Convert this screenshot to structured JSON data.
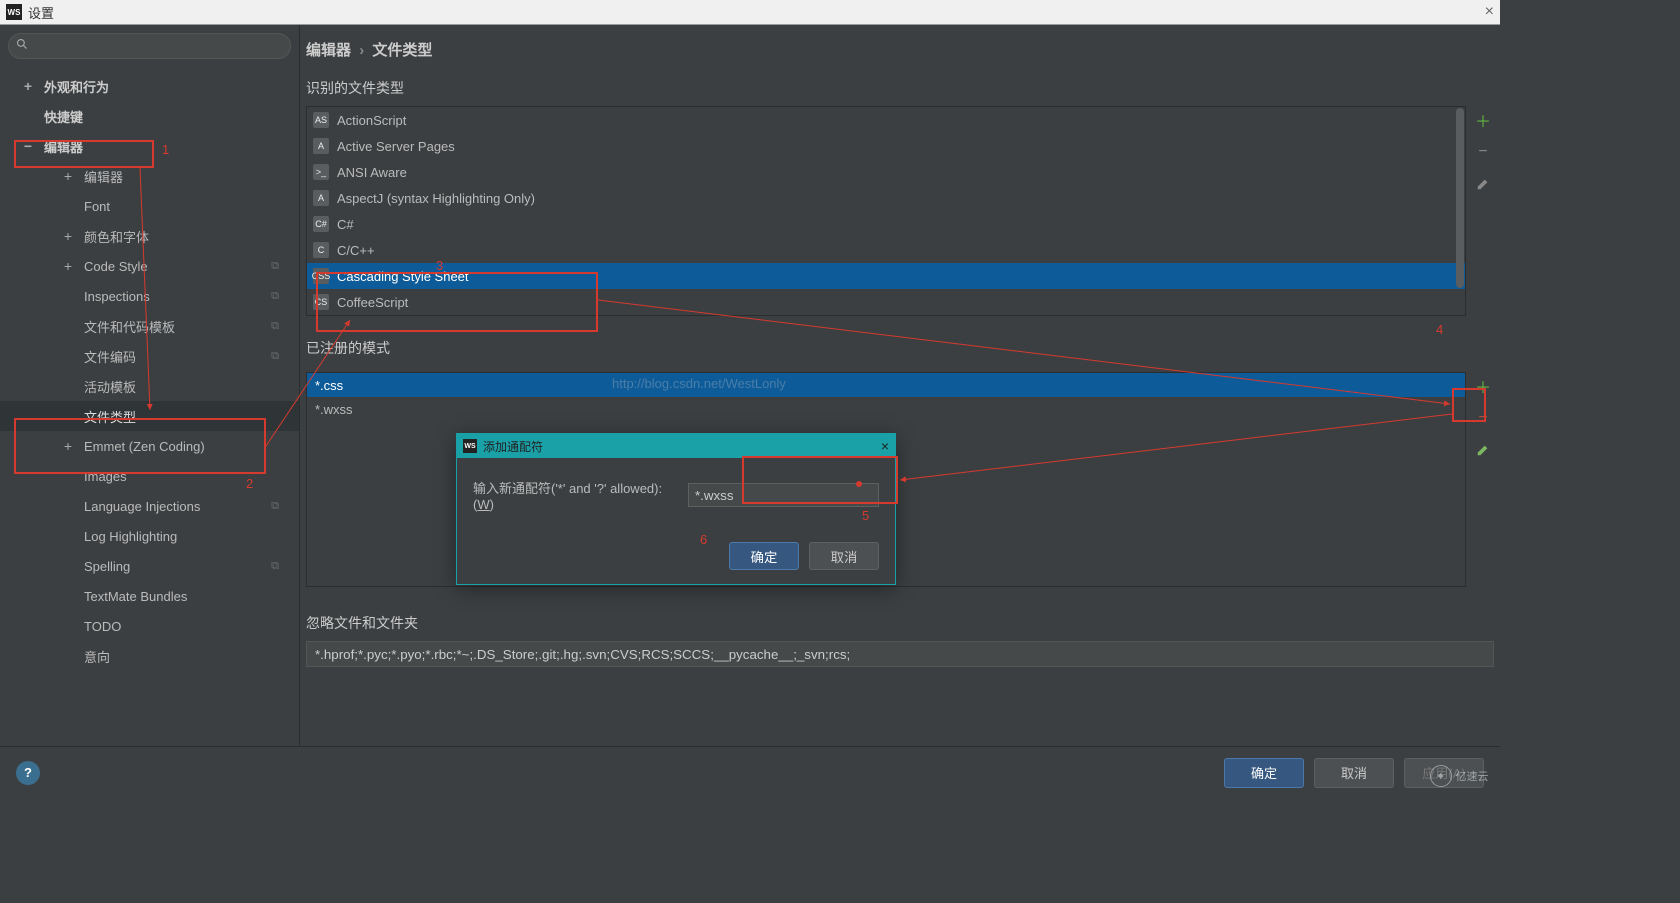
{
  "titlebar": {
    "icon": "WS",
    "title": "设置"
  },
  "search": {
    "placeholder": ""
  },
  "breadcrumb": {
    "part1": "编辑器",
    "sep": "›",
    "part2": "文件类型"
  },
  "sidebar": {
    "items": [
      {
        "exp": "+",
        "label": "外观和行为",
        "bold": true
      },
      {
        "exp": "",
        "label": "快捷键",
        "bold": true
      },
      {
        "exp": "−",
        "label": "编辑器",
        "bold": true
      },
      {
        "exp": "+",
        "label": "编辑器",
        "l2": true
      },
      {
        "exp": "",
        "label": "Font",
        "l2": true
      },
      {
        "exp": "+",
        "label": "颜色和字体",
        "l2": true
      },
      {
        "exp": "+",
        "label": "Code Style",
        "l2": true,
        "copy": true
      },
      {
        "exp": "",
        "label": "Inspections",
        "l2": true,
        "copy": true
      },
      {
        "exp": "",
        "label": "文件和代码模板",
        "l2": true,
        "copy": true
      },
      {
        "exp": "",
        "label": "文件编码",
        "l2": true,
        "copy": true
      },
      {
        "exp": "",
        "label": "活动模板",
        "l2": true
      },
      {
        "exp": "",
        "label": "文件类型",
        "l2": true,
        "selected": true
      },
      {
        "exp": "+",
        "label": "Emmet (Zen Coding)",
        "l2": true
      },
      {
        "exp": "",
        "label": "Images",
        "l2": true
      },
      {
        "exp": "",
        "label": "Language Injections",
        "l2": true,
        "copy": true
      },
      {
        "exp": "",
        "label": "Log Highlighting",
        "l2": true
      },
      {
        "exp": "",
        "label": "Spelling",
        "l2": true,
        "copy": true
      },
      {
        "exp": "",
        "label": "TextMate Bundles",
        "l2": true
      },
      {
        "exp": "",
        "label": "TODO",
        "l2": true
      },
      {
        "exp": "",
        "label": "意向",
        "l2": true
      }
    ]
  },
  "sections": {
    "recognized": "识别的文件类型",
    "registered": "已注册的模式",
    "ignore": "忽略文件和文件夹"
  },
  "filetypes": [
    {
      "icon": "AS",
      "label": "ActionScript"
    },
    {
      "icon": "A",
      "label": "Active Server Pages"
    },
    {
      "icon": ">_",
      "label": "ANSI Aware"
    },
    {
      "icon": "A",
      "label": "AspectJ (syntax Highlighting Only)"
    },
    {
      "icon": "C#",
      "label": "C#"
    },
    {
      "icon": "C",
      "label": "C/C++"
    },
    {
      "icon": "CSS",
      "label": "Cascading Style Sheet",
      "selected": true
    },
    {
      "icon": "CS",
      "label": "CoffeeScript"
    }
  ],
  "patterns": [
    {
      "label": "*.css",
      "selected": true
    },
    {
      "label": "*.wxss"
    }
  ],
  "patterns_url": "http://blog.csdn.net/WestLonly",
  "ignore_value": "*.hprof;*.pyc;*.pyo;*.rbc;*~;.DS_Store;.git;.hg;.svn;CVS;RCS;SCCS;__pycache__;_svn;rcs;",
  "footer": {
    "ok": "确定",
    "cancel": "取消",
    "apply": "应用(A)"
  },
  "dialog": {
    "title": "添加通配符",
    "label_pre": "输入新通配符('*' and '?' allowed): (",
    "label_u": "W",
    "label_post": ")",
    "value": "*.wxss",
    "ok": "确定",
    "cancel": "取消"
  },
  "annotations": {
    "n1": "1",
    "n2": "2",
    "n3": "3",
    "n4": "4",
    "n5": "5",
    "n6": "6"
  },
  "watermark": "亿速云"
}
